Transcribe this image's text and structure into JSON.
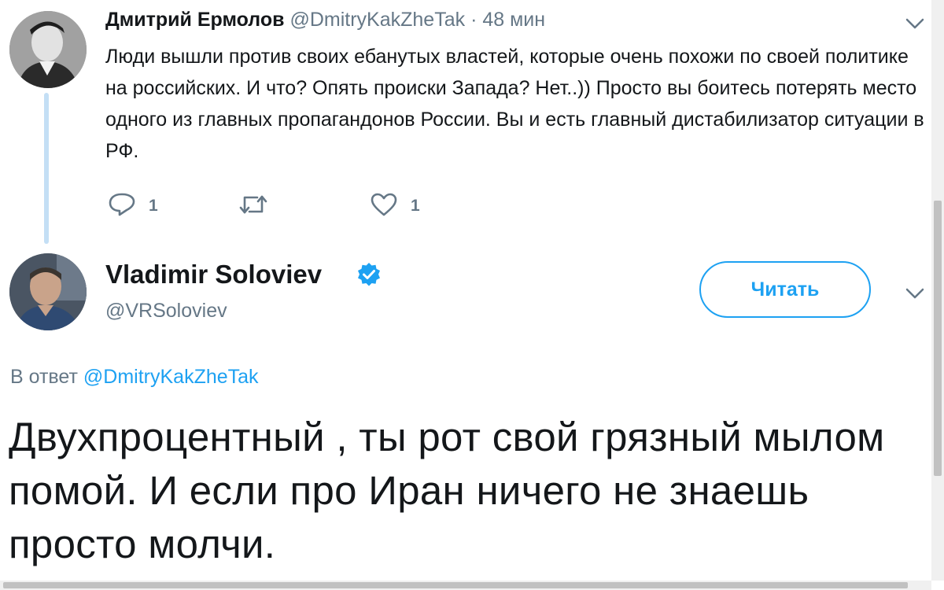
{
  "parent_tweet": {
    "name": "Дмитрий Ермолов",
    "handle": "@DmitryKakZheTak",
    "separator": "·",
    "time": "48 мин",
    "text": "Люди вышли против своих ебанутых властей, которые очень похожи по своей политике на российских. И что? Опять происки Запада? Нет..)) Просто вы боитесь потерять место одного из главных пропагандонов России. Вы и есть главный дистабилизатор ситуации в РФ.",
    "reply_count": "1",
    "like_count": "1",
    "icons": [
      "reply-icon",
      "retweet-icon",
      "like-icon",
      "chevron-down-icon"
    ]
  },
  "main_tweet": {
    "name": "Vladimir Soloviev",
    "handle": "@VRSoloviev",
    "verified": true,
    "follow_label": "Читать",
    "reply_to_prefix": "В ответ",
    "reply_to_handle": "@DmitryKakZheTak",
    "text": "Двухпроцентный , ты рот свой грязный мылом помой. И если про Иран ничего не знаешь просто молчи."
  },
  "colors": {
    "accent": "#1da1f2",
    "secondary_text": "#657786",
    "thread_line": "#c4dff5"
  }
}
